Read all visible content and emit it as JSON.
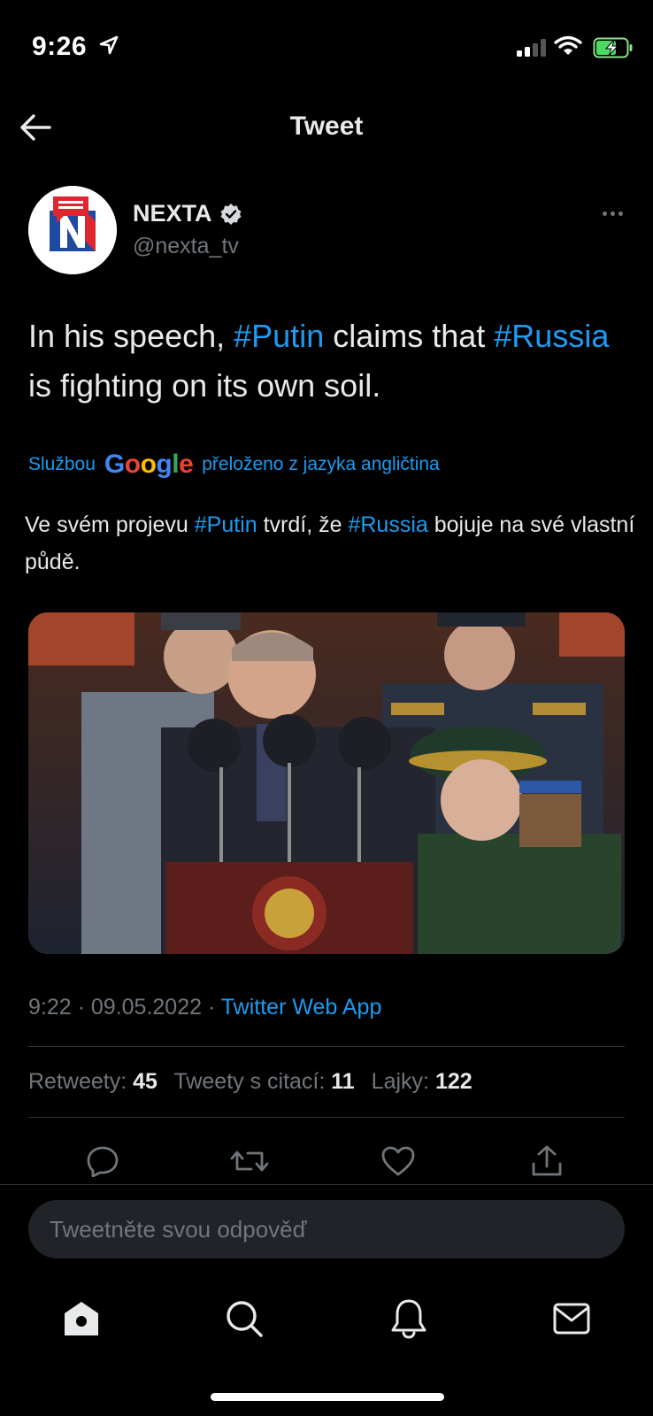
{
  "status_bar": {
    "time": "9:26"
  },
  "nav": {
    "title": "Tweet"
  },
  "author": {
    "name": "NEXTA",
    "handle": "@nexta_tv"
  },
  "tweet": {
    "text_parts": [
      {
        "text": "In his speech, ",
        "hashtag": false
      },
      {
        "text": "#Putin",
        "hashtag": true
      },
      {
        "text": " claims that ",
        "hashtag": false
      },
      {
        "text": "#Russia",
        "hashtag": true
      },
      {
        "text": " is fighting on its own soil.",
        "hashtag": false
      }
    ],
    "translated_prefix": "Službou",
    "translated_brand": "Google",
    "translated_suffix": "přeloženo z jazyka angličtina",
    "translation_parts": [
      {
        "text": "Ve svém projevu ",
        "hashtag": false
      },
      {
        "text": "#Putin",
        "hashtag": true
      },
      {
        "text": " tvrdí, že ",
        "hashtag": false
      },
      {
        "text": "#Russia",
        "hashtag": true
      },
      {
        "text": " bojuje na své vlastní půdě.",
        "hashtag": false
      }
    ]
  },
  "meta": {
    "time": "9:22",
    "date": "09.05.2022",
    "separator": " · ",
    "source": "Twitter Web App"
  },
  "stats": {
    "retweets_label": "Retweety:",
    "retweets": "45",
    "quotes_label": "Tweety s citací:",
    "quotes": "11",
    "likes_label": "Lajky:",
    "likes": "122"
  },
  "reply": {
    "placeholder": "Tweetněte svou odpověď"
  },
  "colors": {
    "accent": "#1d9bf0",
    "background": "#000000",
    "muted": "#71767b"
  },
  "icons": [
    "back-arrow-icon",
    "verified-badge-icon",
    "more-icon",
    "reply-icon",
    "retweet-icon",
    "like-icon",
    "share-icon",
    "home-icon",
    "search-icon",
    "notifications-icon",
    "messages-icon"
  ]
}
